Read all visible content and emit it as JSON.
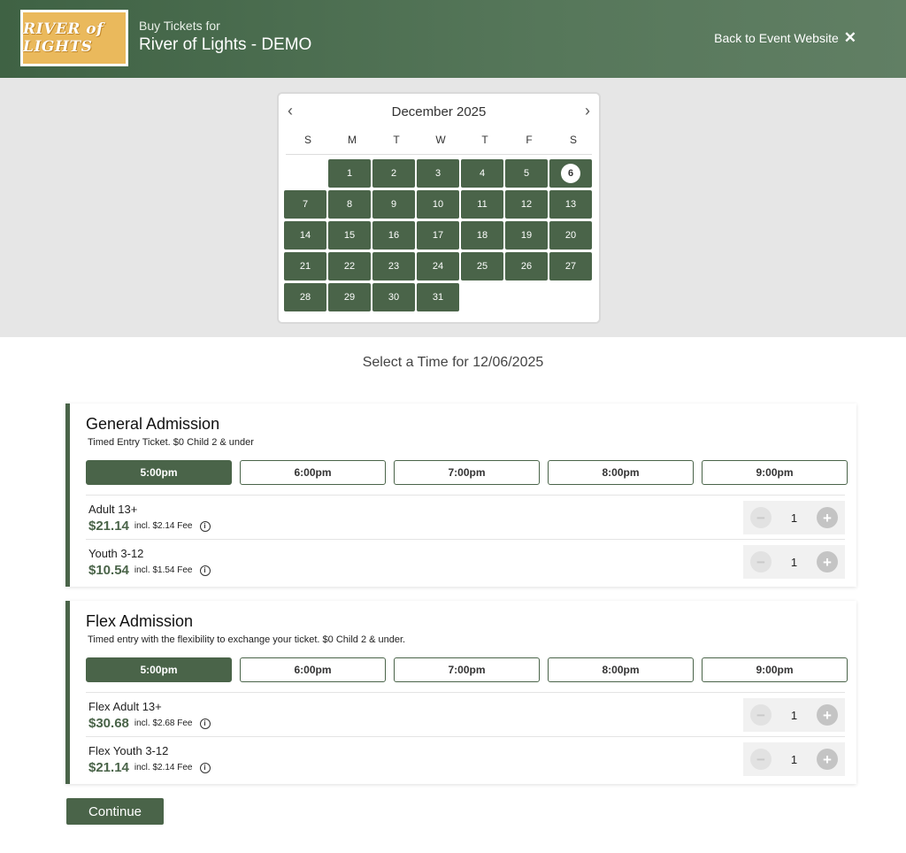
{
  "header": {
    "logo_text": "RIVER of LIGHTS",
    "subtitle": "Buy Tickets for",
    "title": "River of Lights - DEMO",
    "back_link": "Back to Event Website",
    "back_icon": "✕"
  },
  "calendar": {
    "month_label": "December 2025",
    "prev_icon": "‹",
    "next_icon": "›",
    "weekdays": [
      "S",
      "M",
      "T",
      "W",
      "T",
      "F",
      "S"
    ],
    "leading_blanks": 1,
    "days": [
      "1",
      "2",
      "3",
      "4",
      "5",
      "6",
      "7",
      "8",
      "9",
      "10",
      "11",
      "12",
      "13",
      "14",
      "15",
      "16",
      "17",
      "18",
      "19",
      "20",
      "21",
      "22",
      "23",
      "24",
      "25",
      "26",
      "27",
      "28",
      "29",
      "30",
      "31"
    ],
    "selected_day": "6"
  },
  "select_time_label": "Select a Time for 12/06/2025",
  "sections": [
    {
      "title": "General Admission",
      "description": "Timed Entry Ticket. $0 Child 2 & under",
      "times": [
        "5:00pm",
        "6:00pm",
        "7:00pm",
        "8:00pm",
        "9:00pm"
      ],
      "selected_time": "5:00pm",
      "tickets": [
        {
          "name": "Adult 13+",
          "price": "$21.14",
          "fee": "incl. $2.14 Fee",
          "qty": "1"
        },
        {
          "name": "Youth 3-12",
          "price": "$10.54",
          "fee": "incl. $1.54 Fee",
          "qty": "1"
        }
      ]
    },
    {
      "title": "Flex Admission",
      "description": "Timed entry with the flexibility to exchange your ticket. $0 Child 2 & under.",
      "times": [
        "5:00pm",
        "6:00pm",
        "7:00pm",
        "8:00pm",
        "9:00pm"
      ],
      "selected_time": "5:00pm",
      "tickets": [
        {
          "name": "Flex Adult 13+",
          "price": "$30.68",
          "fee": "incl. $2.68 Fee",
          "qty": "1"
        },
        {
          "name": "Flex Youth 3-12",
          "price": "$21.14",
          "fee": "incl. $2.14 Fee",
          "qty": "1"
        }
      ]
    }
  ],
  "continue_label": "Continue",
  "icons": {
    "info": "i",
    "minus": "−",
    "plus": "+"
  },
  "colors": {
    "brand_green": "#4a6449",
    "logo_gold": "#eab95c",
    "band_gray": "#e6e6e6"
  }
}
